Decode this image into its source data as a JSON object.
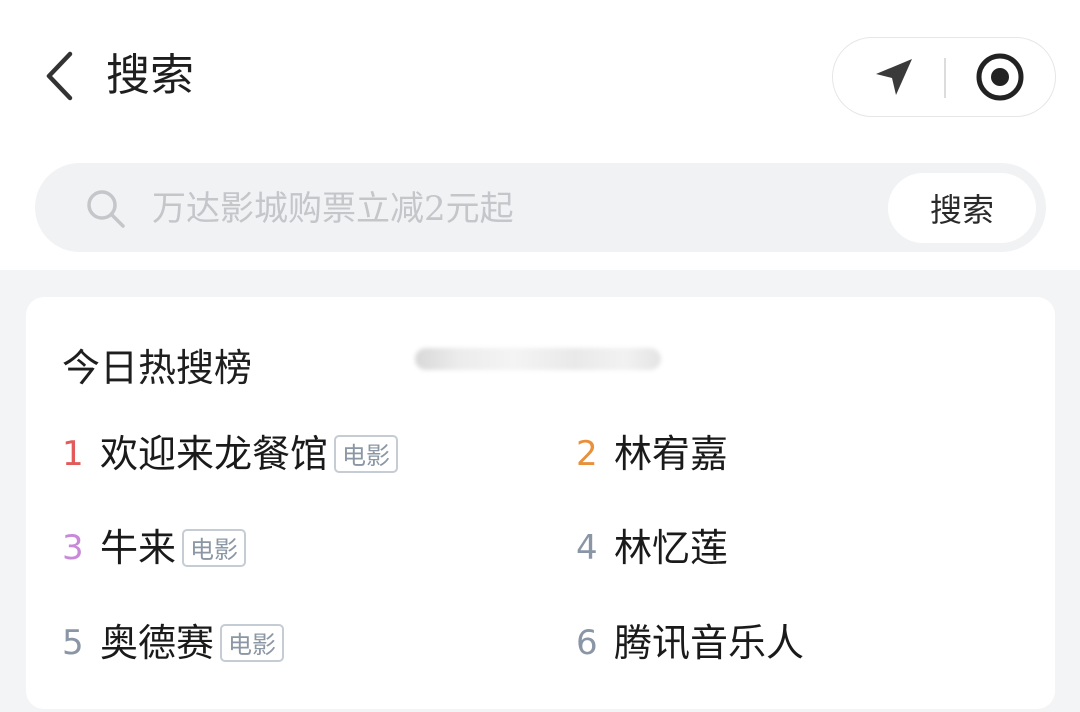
{
  "header": {
    "title": "搜索"
  },
  "search": {
    "placeholder": "万达影城购票立减2元起",
    "value": "",
    "button_label": "搜索"
  },
  "hot": {
    "title": "今日热搜榜",
    "items": [
      {
        "rank": "1",
        "keyword": "欢迎来龙餐馆",
        "tag": "电影",
        "rank_color": "#e35a5a"
      },
      {
        "rank": "2",
        "keyword": "林宥嘉",
        "tag": "",
        "rank_color": "#e8913a"
      },
      {
        "rank": "3",
        "keyword": "牛来",
        "tag": "电影",
        "rank_color": "#c88ad8"
      },
      {
        "rank": "4",
        "keyword": "林忆莲",
        "tag": "",
        "rank_color": "#8a96a6"
      },
      {
        "rank": "5",
        "keyword": "奥德赛",
        "tag": "电影",
        "rank_color": "#8a96a6"
      },
      {
        "rank": "6",
        "keyword": "腾讯音乐人",
        "tag": "",
        "rank_color": "#8a96a6"
      }
    ]
  },
  "colors": {
    "page_bg": "#f3f4f6",
    "icon": "#3a3a3a",
    "placeholder": "#c4c6ca",
    "tag_border": "#c6ccd3",
    "tag_text": "#8b97a4"
  },
  "icons": {
    "back": "chevron-left-icon",
    "location": "navigation-arrow-icon",
    "record": "record-circle-icon",
    "search": "magnifier-icon"
  }
}
